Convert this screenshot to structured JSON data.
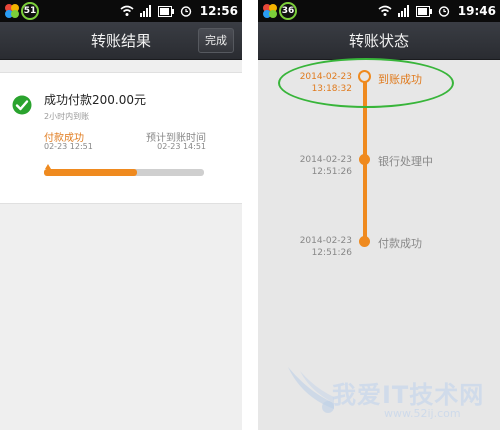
{
  "left_screen": {
    "status": {
      "badge": "51",
      "time": "12:56"
    },
    "title": "转账结果",
    "done_button": "完成",
    "result": {
      "amount_text": "成功付款200.00元",
      "eta_hint": "2小时内到账",
      "stage_left": {
        "label": "付款成功",
        "time": "02-23 12:51"
      },
      "stage_right": {
        "label": "预计到账时间",
        "time": "02-23 14:51"
      },
      "progress_percent": 58
    }
  },
  "right_screen": {
    "status": {
      "badge": "36",
      "time": "19:46"
    },
    "title": "转账状态",
    "timeline": [
      {
        "date": "2014-02-23",
        "time": "13:18:32",
        "label": "到账成功",
        "active": true
      },
      {
        "date": "2014-02-23",
        "time": "12:51:26",
        "label": "银行处理中",
        "active": false
      },
      {
        "date": "2014-02-23",
        "time": "12:51:26",
        "label": "付款成功",
        "active": false
      }
    ]
  },
  "watermark": {
    "text": "我爱IT技术网",
    "url": "www.52ij.com"
  },
  "colors": {
    "accent": "#ef8a1f",
    "success": "#2aa32e",
    "highlight": "#38b53a",
    "titlebar": "#303238"
  }
}
